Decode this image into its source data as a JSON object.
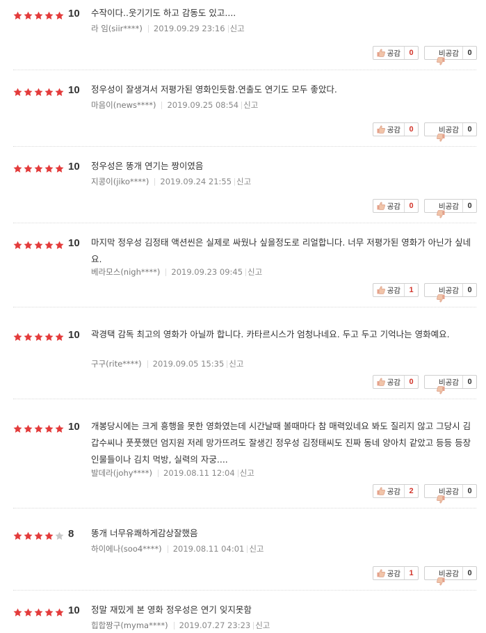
{
  "labels": {
    "like": "공감",
    "dislike": "비공감",
    "report": "신고"
  },
  "colors": {
    "star_filled": "#e33b3b",
    "star_empty": "#c8c8c8",
    "like_count": "#d2342a"
  },
  "reviews": [
    {
      "stars": 5,
      "score": "10",
      "text": "수작이다..웃기기도 하고 감동도 있고....",
      "author": "라 임(siir****)",
      "date": "2019.09.29 23:16",
      "likes": "0",
      "dislikes": "0"
    },
    {
      "stars": 5,
      "score": "10",
      "text": "정우성이 잘생겨서 저평가된 영화인듯함.연출도 연기도 모두 좋았다.",
      "author": "마음이(news****)",
      "date": "2019.09.25 08:54",
      "likes": "0",
      "dislikes": "0"
    },
    {
      "stars": 5,
      "score": "10",
      "text": "정우성은 똥개 연기는 짱이였음",
      "author": "지콩이(jiko****)",
      "date": "2019.09.24 21:55",
      "likes": "0",
      "dislikes": "0"
    },
    {
      "stars": 5,
      "score": "10",
      "text": "마지막 정우성 김정태 액션씬은 실제로 싸웠나 싶을정도로 리얼합니다. 너무 저평가된 영화가 아닌가 싶네요.",
      "author": "베라모스(nigh****)",
      "date": "2019.09.23 09:45",
      "likes": "1",
      "dislikes": "0"
    },
    {
      "stars": 5,
      "score": "10",
      "text": "곽경택 감독 최고의 영화가 아닐까 합니다. 카타르시스가 엄청나네요. 두고 두고 기억나는 영화예요.",
      "author": "구구(rite****)",
      "date": "2019.09.05 15:35",
      "likes": "0",
      "dislikes": "0"
    },
    {
      "stars": 5,
      "score": "10",
      "text": "개봉당시에는 크게 흥행을 못한 영화였는데 시간날때 볼때마다 참 매력있네요 봐도 질리지 않고 그당시 김갑수씨나 풋풋했던 엄지원 저레 망가뜨려도 잘생긴 정우성 김정태씨도 진짜 동네 양아치 같았고 등등 등장인물들이나 김치 먹방, 실력의 자궁....",
      "author": "발데라(johy****)",
      "date": "2019.08.11 12:04",
      "likes": "2",
      "dislikes": "0"
    },
    {
      "stars": 4,
      "score": "8",
      "text": "똥개 너무유쾌하게감상잘했음",
      "author": "하이에나(soo4****)",
      "date": "2019.08.11 04:01",
      "likes": "1",
      "dislikes": "0"
    },
    {
      "stars": 5,
      "score": "10",
      "text": "정말 재밌게 본 영화 정우성은 연기 잊지못함",
      "author": "힙합짱구(myma****)",
      "date": "2019.07.27 23:23",
      "likes": null,
      "dislikes": null
    }
  ]
}
